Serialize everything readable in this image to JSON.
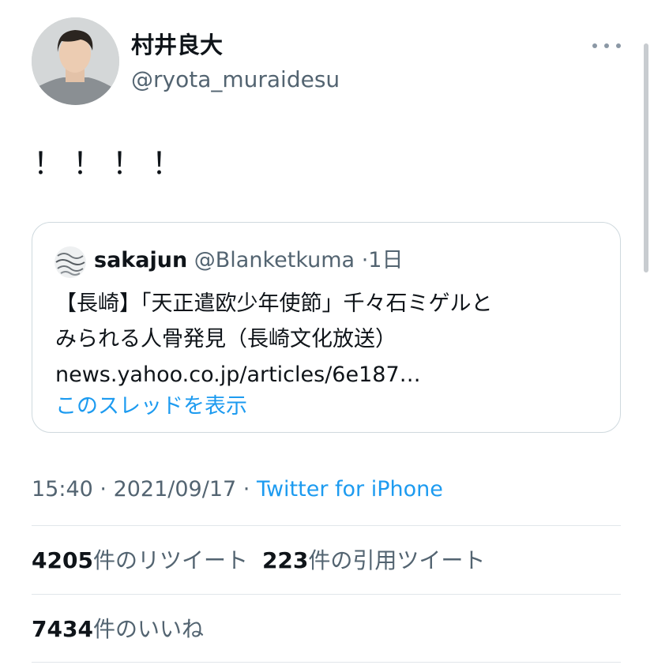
{
  "author": {
    "display_name": "村井良大",
    "handle": "@ryota_muraidesu"
  },
  "tweet": {
    "text": "！！！！"
  },
  "quoted_tweet": {
    "display_name": "sakajun",
    "handle": "@Blanketkuma",
    "separator": "·",
    "time": "1日",
    "lines": [
      "【長崎】「天正遣欧少年使節」千々石ミゲルと",
      "みられる人骨発見（長崎文化放送）",
      "news.yahoo.co.jp/articles/6e187…"
    ],
    "show_thread": "このスレッドを表示"
  },
  "meta": {
    "time": "15:40",
    "sep1": " · ",
    "date": "2021/09/17",
    "sep2": " · ",
    "source": "Twitter for iPhone"
  },
  "stats": {
    "retweets_count": "4205",
    "retweets_label": "件のリツイート",
    "quotes_count": "223",
    "quotes_label": "件の引用ツイート",
    "likes_count": "7434",
    "likes_label": "件のいいね"
  },
  "icons": {
    "more": "more-horizontal-icon"
  },
  "colors": {
    "link": "#1d9bf0",
    "secondary_text": "#536471",
    "primary_text": "#0f1419",
    "border": "#cfd9de"
  }
}
